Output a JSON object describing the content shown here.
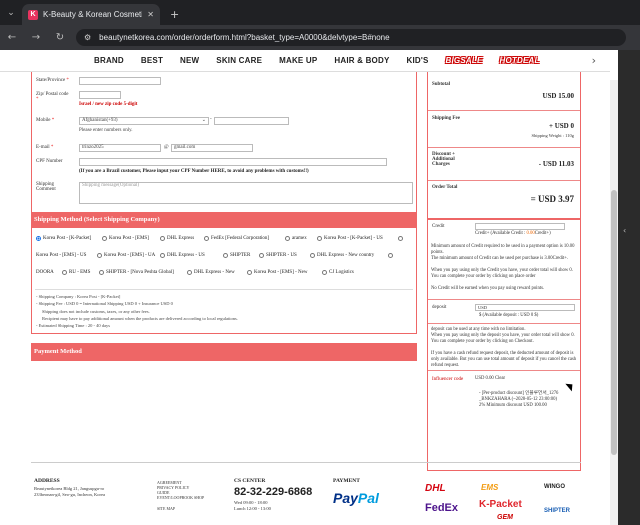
{
  "browser": {
    "tab_title": "K-Beauty & Korean Cosmetics",
    "favicon_letter": "K",
    "url": "beautynetkorea.com/order/orderform.html?basket_type=A0000&delvtype=B#none"
  },
  "nav": {
    "items": [
      "BRAND",
      "BEST",
      "NEW",
      "SKIN CARE",
      "MAKE UP",
      "HAIR & BODY",
      "KID'S"
    ],
    "promo1": "BIGSALE",
    "promo2": "HOTDEAL"
  },
  "form": {
    "state_label": "State/Province",
    "zip_label": "Zip/ Postal code",
    "zip_note": "Israel / new zip code 5-digit",
    "mobile_label": "Mobile",
    "mobile_country": "Afghanistan(+93)",
    "mobile_note": "Please enter numbers only.",
    "email_label": "E-mail",
    "email_user": "trinzo2025",
    "email_at": "@",
    "email_domain": "gmail.com",
    "cpf_label": "CPF Number",
    "cpf_note": "(If you are a Brazil customer, Please input your CPF Number HERE, to avoid any problems with customs!!)",
    "shipping_comment_label1": "Shipping",
    "shipping_comment_label2": "Comment",
    "shipping_comment_placeholder": "Shipping message(Optional)"
  },
  "shipping_method": {
    "title": "Shipping Method (Select Shipping Company)",
    "options_row1": [
      "Korea Post - [K-Packet]",
      "Korea Post - [EMS]",
      "DHL Express",
      "FedEx [Federal Corporation]",
      "aramex",
      "Korea Post - [K-Packet] - US"
    ],
    "options_row2": [
      "Korea Post - [EMS] - US",
      "Korea Post - [EMS] - UA",
      "DHL Express - US",
      "SHIPTER",
      "SHIPTER - US",
      "DHL Express - New country"
    ],
    "options_row3": [
      "DOORA",
      "RU - EMS",
      "SHIPTER - [Nova Peshta Global]",
      "DHL Express - New",
      "Korea Post - [EMS] - New",
      "CJ Logistics"
    ],
    "info": [
      "- Shipping Company : Korea Post - [K-Packet]",
      "- Shipping Fee : USD 0 = International Shipping USD 0 + Insurance USD 0",
      "Shipping does not include customs, taxes, or any other fees.",
      "Recipient may have to pay additional amount when the products are delivered according to local regulations.",
      "- Estimated Shipping Time : 20 - 40 days"
    ]
  },
  "payment_method": {
    "title": "Payment Method"
  },
  "summary": {
    "subtotal_label": "Subtotal",
    "subtotal_value": "USD 15.00",
    "shipping_label": "Shipping Fee",
    "shipping_value": "+ USD 0",
    "shipping_weight": "Shipping Weight : 110g",
    "discount_label1": "Discount +",
    "discount_label2": "Additional",
    "discount_label3": "Charges",
    "discount_value": "- USD 11.03",
    "total_label": "Order Total",
    "total_value": "= USD 3.97"
  },
  "credit": {
    "label": "Credit",
    "available_prefix": "Credit+ (Available Credit :",
    "available_value": "0.00",
    "available_suffix": "Credit+)",
    "notes": [
      "Minimum amount of Credit required to be used in a payment option is 10.00 points.",
      "The minimum amount of Credit can be used per purchase is 3.00Credit+.",
      "When you pay using only the Credit you have, your order total will show 0. You can complete your order by clicking on place order",
      "No Credit will be earned when you pay using reward points."
    ],
    "deposit_label": "deposit",
    "deposit_currency": "USD",
    "deposit_available": "$ (Available deposit : USD 0 $)",
    "deposit_notes": [
      "deposit can be used at any time with no limitation.",
      "When you pay using only the deposit you have, your order total will show 0. You can complete your order by clicking on Checkout.",
      "If you have a cash refund request deposit, the deducted amount of deposit is only available. But you can use total amount of deposit if you cancel the cash refund request."
    ],
    "influencer_label": "Influencer code",
    "influencer_value": "USD 0.00",
    "clear_button": "Clear",
    "discount_lines": [
      "- [Per-product discount] 인플루언서_1276",
      "_BNKZAHARA (~2028-05-12 23:00:00)",
      "2% Minimum discount USD 100.00"
    ]
  },
  "footer": {
    "address_title": "ADDRESS",
    "address_lines": [
      "Beautynetkorea Bldg 21, Jangsupgu-ro",
      "233beonan-gil, Seo-gu, Incheon, Korea"
    ],
    "links": [
      "AGREEMENT",
      "PRIVACY POLICY",
      "GUIDE",
      "EVENT/LOOPBOOK SHOP",
      "SITE MAP"
    ],
    "cs_title": "CS CENTER",
    "cs_phone": "82-32-229-6868",
    "cs_hours": [
      "Wed 09:00 - 18:00",
      "Lunch 12:00 - 13:00"
    ],
    "payment_title": "PAYMENT",
    "paypal_1": "Pay",
    "paypal_2": "Pal",
    "carriers": [
      "DHL",
      "EMS",
      "WINGO",
      "FedEx",
      "K-Packet",
      "GEM",
      "SHIPTER"
    ]
  }
}
